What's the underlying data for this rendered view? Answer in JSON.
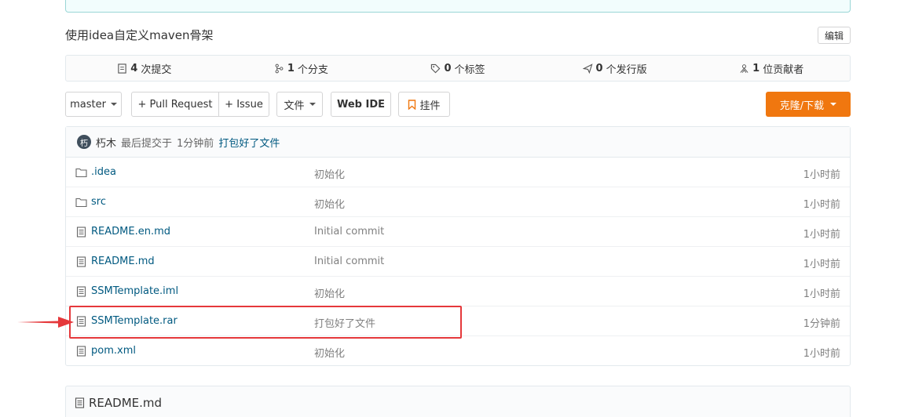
{
  "repo": {
    "description": "使用idea自定义maven骨架",
    "edit_label": "编辑"
  },
  "stats": [
    {
      "icon": "commit-icon",
      "count": "4",
      "label": "次提交"
    },
    {
      "icon": "branch-icon",
      "count": "1",
      "label": "个分支"
    },
    {
      "icon": "tag-icon",
      "count": "0",
      "label": "个标签"
    },
    {
      "icon": "release-icon",
      "count": "0",
      "label": "个发行版"
    },
    {
      "icon": "contributor-icon",
      "count": "1",
      "label": "位贡献者"
    }
  ],
  "toolbar": {
    "branch": "master",
    "pull_request": "+ Pull Request",
    "issue": "+ Issue",
    "file_menu": "文件",
    "web_ide": "Web IDE",
    "pendant": "挂件",
    "clone": "克隆/下载"
  },
  "last_commit": {
    "avatar_text": "朽",
    "author": "朽木",
    "prefix": "最后提交于",
    "time": "1分钟前",
    "message": "打包好了文件"
  },
  "files": [
    {
      "type": "folder",
      "name": ".idea",
      "message": "初始化",
      "time": "1小时前"
    },
    {
      "type": "folder",
      "name": "src",
      "message": "初始化",
      "time": "1小时前"
    },
    {
      "type": "file",
      "name": "README.en.md",
      "message": "Initial commit",
      "time": "1小时前"
    },
    {
      "type": "file",
      "name": "README.md",
      "message": "Initial commit",
      "time": "1小时前"
    },
    {
      "type": "file",
      "name": "SSMTemplate.iml",
      "message": "初始化",
      "time": "1小时前"
    },
    {
      "type": "file",
      "name": "SSMTemplate.rar",
      "message": "打包好了文件",
      "time": "1分钟前"
    },
    {
      "type": "file",
      "name": "pom.xml",
      "message": "初始化",
      "time": "1小时前"
    }
  ],
  "readme": {
    "title": "README.md"
  },
  "colors": {
    "accent": "#f0770f",
    "link": "#005980",
    "annotation": "#e5383b"
  }
}
